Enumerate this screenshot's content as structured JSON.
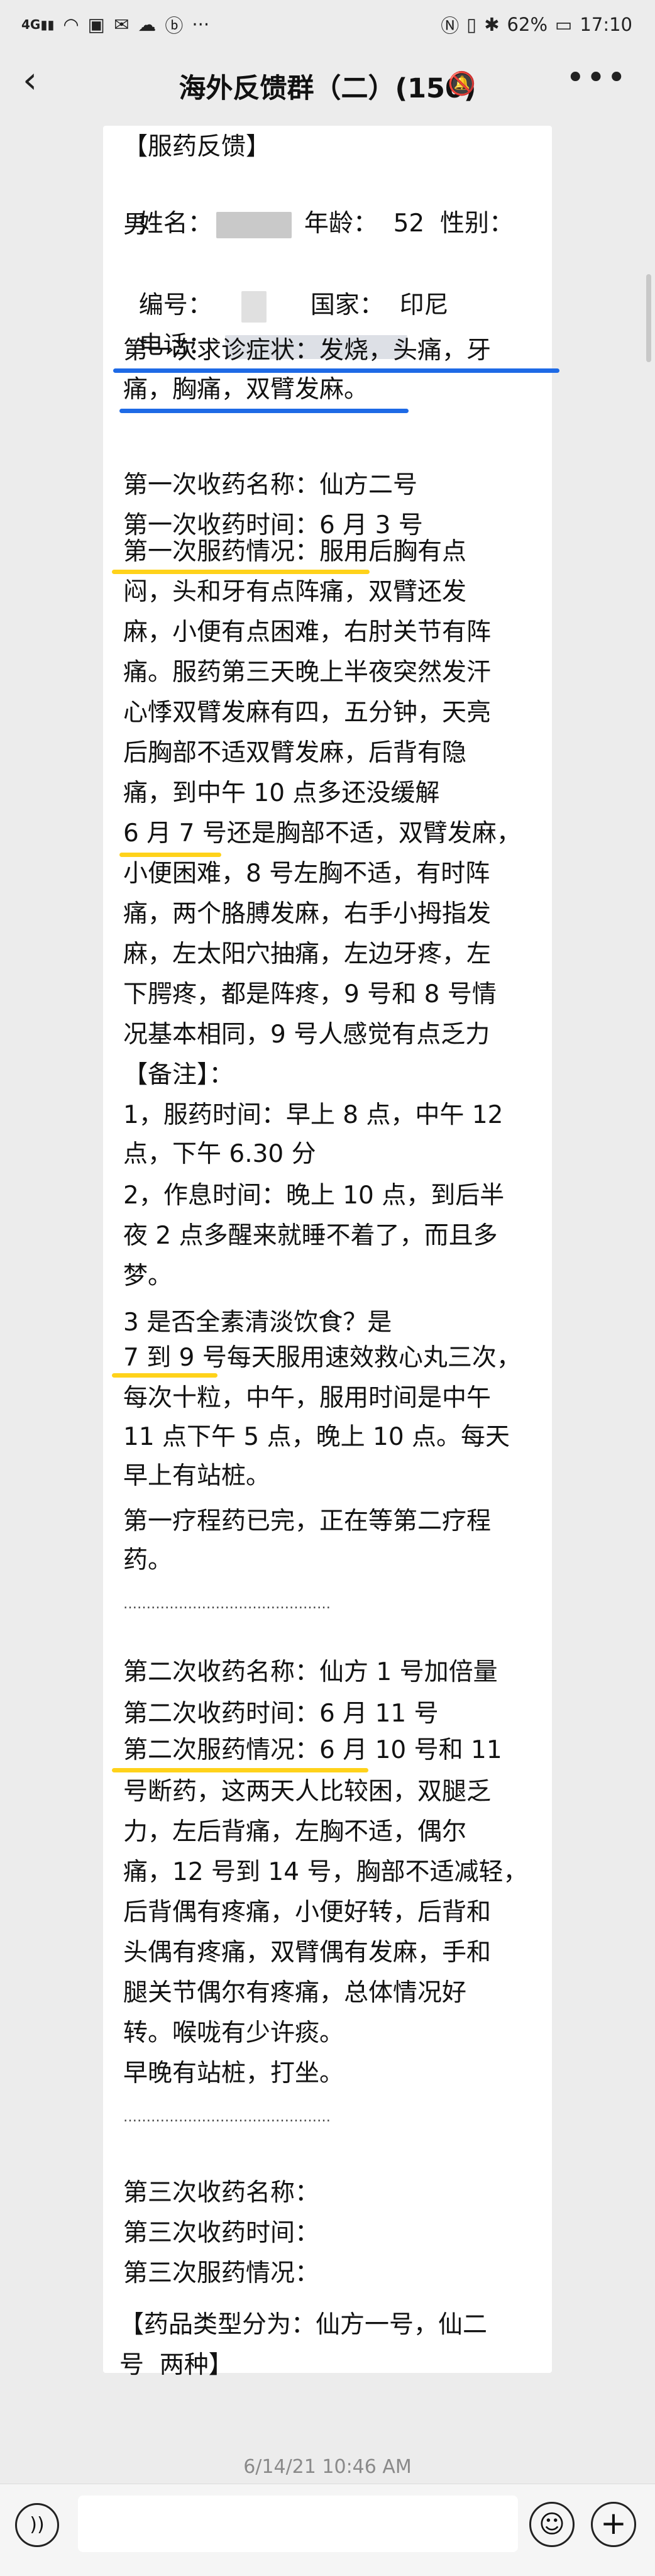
{
  "status_bar": {
    "left_icons": [
      "4G",
      "wifi",
      "image",
      "mail",
      "cloud",
      "b"
    ],
    "dots": "···",
    "battery": "62%",
    "time": "17:10"
  },
  "chat": {
    "title": "海外反馈群（二）(150)",
    "muted_icon": "bell-off-icon",
    "more_icon": "more-icon"
  },
  "message": {
    "lines": [
      "【服药反馈】",
      "姓名：",
      "年龄：  52  性别：",
      "男",
      "编号：",
      "国家：  印尼",
      "电话：",
      "第一次求诊症状：发烧，头痛，牙",
      "痛，胸痛，双臂发麻。",
      "第一次收药名称：仙方二号",
      "第一次收药时间：6 月 3 号",
      "第一次服药情况：服用后胸有点",
      "闷，头和牙有点阵痛，双臂还发",
      "麻，小便有点困难，右肘关节有阵",
      "痛。服药第三天晚上半夜突然发汗",
      "心悸双臂发麻有四，五分钟，天亮",
      "后胸部不适双臂发麻，后背有隐",
      "痛，到中午 10 点多还没缓解",
      "6 月 7 号还是胸部不适，双臂发麻，",
      "小便困难，8 号左胸不适，有时阵",
      "痛，两个胳膊发麻，右手小拇指发",
      "麻，左太阳穴抽痛，左边牙疼，左",
      "下腭疼，都是阵疼，9 号和 8 号情",
      "况基本相同，9 号人感觉有点乏力",
      "【备注】：",
      "1，服药时间：早上 8 点，中午 12",
      "点，下午 6.30 分",
      "2，作息时间：晚上 10 点，到后半",
      "夜 2 点多醒来就睡不着了，而且多",
      "梦。",
      "3 是否全素清淡饮食？是",
      "7 到 9 号每天服用速效救心丸三次，",
      "每次十粒，中午，服用时间是中午",
      "11 点下午 5 点，晚上 10 点。每天",
      "早上有站桩。",
      "第一疗程药已完，正在等第二疗程",
      "药。",
      "………………………………………",
      "第二次收药名称：仙方 1 号加倍量",
      "第二次收药时间：6 月 11 号",
      "第二次服药情况：6 月 10 号和 11",
      "号断药，这两天人比较困，双腿乏",
      "力，左后背痛，左胸不适，偶尔",
      "痛，12 号到 14 号，胸部不适减轻，",
      "后背偶有疼痛，小便好转，后背和",
      "头偶有疼痛，双臂偶有发麻，手和",
      "腿关节偶尔有疼痛，总体情况好",
      "转。喉咙有少许痰。",
      "早晚有站桩，打坐。",
      "………………………………………",
      "第三次收药名称：",
      "第三次收药时间：",
      "第三次服药情况：",
      "【药品类型分为：仙方一号，仙二",
      "号  两种】"
    ]
  },
  "timestamp": "6/14/21 10:46 AM",
  "input_bar": {
    "voice_icon": "voice-icon",
    "emoji_icon": "emoji-icon",
    "plus_icon": "plus-icon"
  }
}
